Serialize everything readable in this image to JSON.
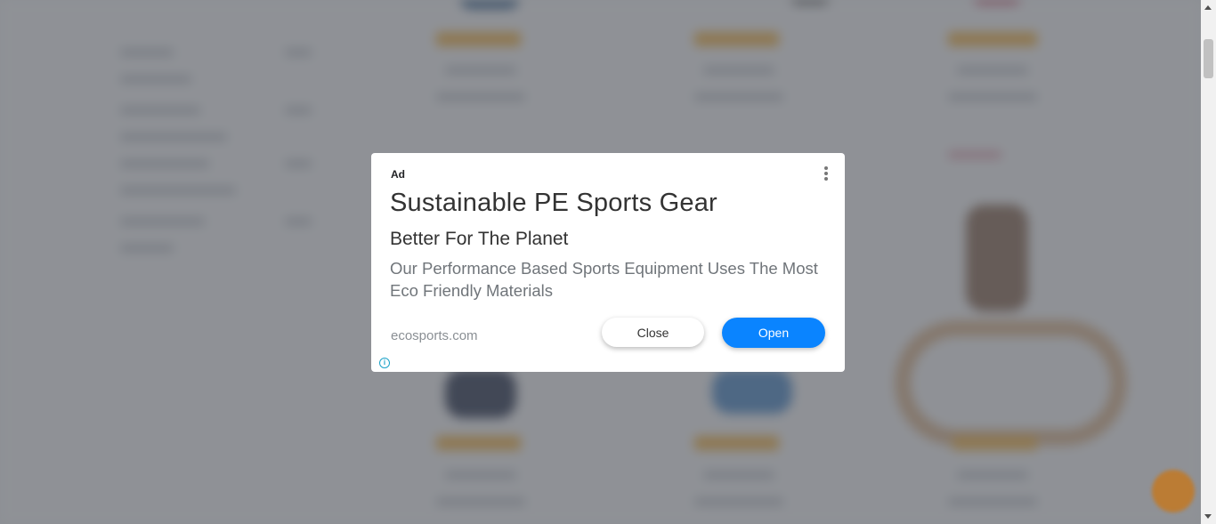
{
  "ad": {
    "badge": "Ad",
    "headline": "Sustainable PE Sports Gear",
    "subheadline": "Better For The Planet",
    "description": "Our Performance Based Sports Equipment Uses The Most Eco Friendly Materials",
    "domain": "ecosports.com",
    "close_label": "Close",
    "open_label": "Open",
    "info_glyph": "i",
    "menu_icon": "vertical-dots-icon",
    "info_icon": "info-circle-icon"
  },
  "colors": {
    "open_button": "#0a84ff",
    "info_icon": "#1aa1c8",
    "overlay": "rgba(80,84,90,0.62)"
  }
}
